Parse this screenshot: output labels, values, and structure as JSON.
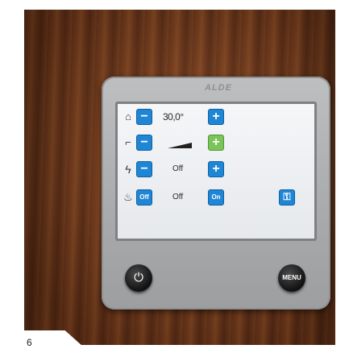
{
  "device": {
    "brand_text": "ALDE",
    "rows": [
      {
        "icon": "house-thermometer-icon",
        "minus": "−",
        "value": "30,0°",
        "plus": "+"
      },
      {
        "icon": "floor-heat-icon",
        "minus": "−",
        "value": "",
        "plus": "+"
      },
      {
        "icon": "lightning-icon",
        "minus": "−",
        "value": "Off",
        "plus": "+"
      },
      {
        "icon": "flame-icon",
        "left": "Off",
        "value": "Off",
        "right": "On"
      }
    ],
    "key_icon": "key-icon",
    "power_icon": "power-icon",
    "menu_label": "MENU"
  },
  "page_number": "6",
  "colors": {
    "button_blue": "#1f86d6",
    "button_green": "#7cc35a",
    "wood": "#6e3719"
  }
}
